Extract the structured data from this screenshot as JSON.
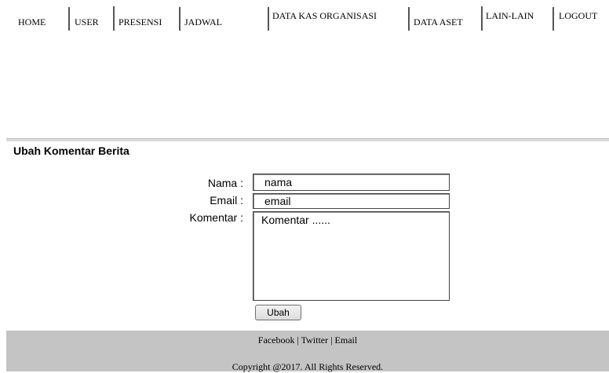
{
  "nav": {
    "items": [
      "HOME",
      "USER",
      "PRESENSI",
      "JADWAL",
      "DATA KAS ORGANISASI",
      "DATA ASET",
      "LAIN-LAIN",
      "LOGOUT"
    ]
  },
  "form": {
    "title": "Ubah Komentar Berita",
    "nama_label": "Nama :",
    "nama_value": "nama",
    "email_label": "Email :",
    "email_value": "email",
    "komentar_label": "Komentar :",
    "komentar_value": "Komentar ......",
    "submit_label": "Ubah"
  },
  "footer": {
    "facebook": "Facebook",
    "twitter": "Twitter",
    "email": "Email",
    "separator": " | ",
    "copyright": "Copyright @2017. All Rights Reserved."
  }
}
